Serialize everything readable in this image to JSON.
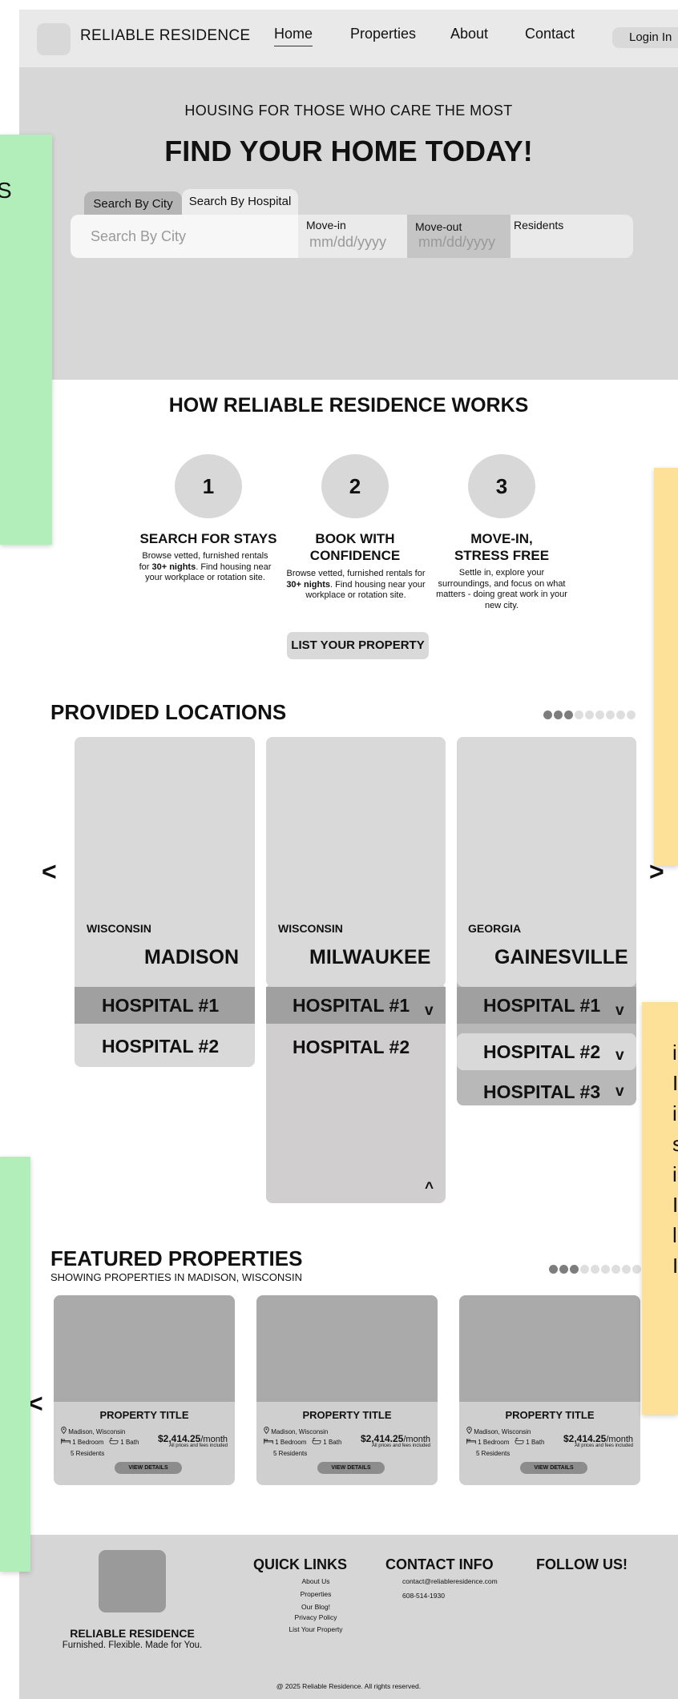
{
  "header": {
    "brand": "RELIABLE RESIDENCE",
    "nav": [
      "Home",
      "Properties",
      "About",
      "Contact"
    ],
    "login": "Login In"
  },
  "hero": {
    "subtitle": "HOUSING FOR THOSE WHO CARE THE MOST",
    "title": "FIND YOUR HOME TODAY!",
    "tabs": [
      "Search By City",
      "Search By Hospital"
    ],
    "search_placeholder": "Search By City",
    "movein_label": "Move-in",
    "movein_placeholder": "mm/dd/yyyy",
    "moveout_label": "Move-out",
    "moveout_placeholder": "mm/dd/yyyy",
    "residents_label": "Residents"
  },
  "how": {
    "title": "HOW RELIABLE RESIDENCE WORKS",
    "steps": [
      {
        "num": "1",
        "title": "SEARCH FOR STAYS",
        "desc_before": "Browse vetted, furnished rentals for ",
        "desc_bold": "30+ nights",
        "desc_after": ". Find housing near your workplace or rotation site."
      },
      {
        "num": "2",
        "title": "BOOK WITH CONFIDENCE",
        "desc_before": "Browse vetted, furnished rentals for ",
        "desc_bold": "30+ nights",
        "desc_after": ". Find housing near your workplace or rotation site."
      },
      {
        "num": "3",
        "title": "MOVE-IN, STRESS FREE",
        "desc": "Settle in, explore your surroundings, and focus on what matters - doing great work in your new city."
      }
    ],
    "cta": "LIST YOUR PROPERTY"
  },
  "locations": {
    "title": "PROVIDED LOCATIONS",
    "prev": "<",
    "next": ">",
    "pager_total": 9,
    "pager_active": 3,
    "cards": [
      {
        "state": "WISCONSIN",
        "city": "MADISON",
        "hospitals": [
          "HOSPITAL #1",
          "HOSPITAL #2"
        ]
      },
      {
        "state": "WISCONSIN",
        "city": "MILWAUKEE",
        "hospitals": [
          "HOSPITAL #1",
          "HOSPITAL #2"
        ],
        "toggle_down": "v",
        "toggle_up": "^"
      },
      {
        "state": "GEORGIA",
        "city": "GAINESVILLE",
        "hospitals": [
          "HOSPITAL #1",
          "HOSPITAL #2",
          "HOSPITAL #3"
        ],
        "toggles": [
          "v",
          "v",
          "v"
        ]
      }
    ]
  },
  "featured": {
    "title": "FEATURED PROPERTIES",
    "subtitle": "SHOWING PROPERTIES IN MADISON, WISCONSIN",
    "prev": "<",
    "pager_total": 9,
    "pager_active": 3,
    "properties": [
      {
        "title": "PROPERTY TITLE",
        "location": "Madison, Wisconsin",
        "bedrooms": "1 Bedroom",
        "baths": "1 Bath",
        "residents": "5 Residents",
        "price": "$2,414.25",
        "period": "/month",
        "note": "All prices and fees included",
        "button": "VIEW DETAILS"
      },
      {
        "title": "PROPERTY TITLE",
        "location": "Madison, Wisconsin",
        "bedrooms": "1 Bedroom",
        "baths": "1 Bath",
        "residents": "5 Residents",
        "price": "$2,414.25",
        "period": "/month",
        "note": "All prices and fees included",
        "button": "VIEW DETAILS"
      },
      {
        "title": "PROPERTY TITLE",
        "location": "Madison, Wisconsin",
        "bedrooms": "1 Bedroom",
        "baths": "1 Bath",
        "residents": "5 Residents",
        "price": "$2,414.25",
        "period": "/month",
        "note": "All prices and fees included",
        "button": "VIEW DETAILS"
      }
    ]
  },
  "footer": {
    "brand": "RELIABLE RESIDENCE",
    "tagline": "Furnished. Flexible. Made for You.",
    "quick_links_title": "QUICK LINKS",
    "quick_links": [
      "About Us",
      "Properties",
      "Our Blog!",
      "Privacy Policy",
      "List Your Property"
    ],
    "contact_title": "CONTACT INFO",
    "email": "contact@reliableresidence.com",
    "phone": "608-514-1930",
    "follow_title": "FOLLOW US!",
    "copyright": "@ 2025 Reliable Residence. All rights reserved."
  },
  "notes": {
    "left_top_fragment": "S",
    "right_bottom_fragments": [
      "i",
      "I",
      "i",
      "s",
      "i",
      "I",
      "l",
      "I"
    ]
  },
  "colors": {
    "note_green": "#b2eeb9",
    "note_yellow": "#fde198",
    "hero_bg": "#d7d7d7",
    "header_bg": "#e9e9e9"
  }
}
